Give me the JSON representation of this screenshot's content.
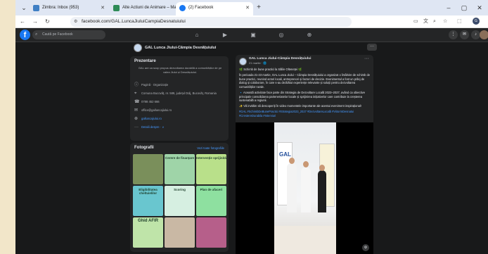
{
  "browser": {
    "tabs": [
      {
        "title": "Zimbra: Inbox (953)",
        "favicon_color": "#3f7fc4"
      },
      {
        "title": "Alte Actiuni de Animare – Mara",
        "favicon_color": "#2e8b57"
      },
      {
        "title": "(2) Facebook",
        "favicon_color": "#1877f2"
      }
    ],
    "new_tab": "+",
    "url": "facebook.com/GAL.LuncaJiuluiCampiaDesnatuiului"
  },
  "facebook": {
    "logo": "f",
    "search_placeholder": "Caută pe Facebook",
    "group_name": "GAL Lunca Jiului-Câmpia Desnățuiului",
    "intro": {
      "title": "Prezentare",
      "description": "GAL are ca scop propus dezvoltarea durabilă a comunităților de pe valea Jiului și Desnățuiului.",
      "rows": [
        {
          "icon": "info-icon",
          "text": "Pagină · Organizație"
        },
        {
          "icon": "location-icon",
          "text": "Comuna Bucovăț, nr. 589, județul Dolj, Bucovăț, Romania"
        },
        {
          "icon": "phone-icon",
          "text": "0788 452 666"
        },
        {
          "icon": "email-icon",
          "text": "office@galluncajiului.ro"
        },
        {
          "icon": "web-icon",
          "text": "galluncajiului.ro",
          "link": true
        },
        {
          "icon": "more-icon",
          "text": "Detalii despre · ∨",
          "link": true
        }
      ]
    },
    "photos": {
      "title": "Fotografii",
      "see_all": "Vezi toate fotografiile",
      "tiles": [
        {
          "label": "",
          "color": "#7a8f5b"
        },
        {
          "label": "Cerere de finanțare",
          "color": "#9fd4a8"
        },
        {
          "label": "Intervenție sprijinită",
          "color": "#b9e08a"
        },
        {
          "label": "Eligibilitatea cheltuielilor",
          "color": "#69c6cf"
        },
        {
          "label": "Scoring",
          "color": "#d6efe1"
        },
        {
          "label": "Plan de afaceri",
          "color": "#8ee0a0"
        },
        {
          "label": "Ghid AFIR",
          "color": "#bfe4a9"
        },
        {
          "label": "",
          "color": "#c9b8a4"
        },
        {
          "label": "",
          "color": "#b65f8a"
        }
      ]
    },
    "post": {
      "author": "GAL Lunca Jiului-Câmpia Desnățuiului",
      "time": "21 martie · 🌐",
      "paragraphs": [
        "🌿 Schimb de bune practici la Sălile Olteneței 🌿",
        "În perioada 21-23 martie, GAL Lunca Jiului – Câmpia Desnățuiului a organizat o întâlnire de schimb de bune practici, reunind actori locali, antreprenori și factori de decizie. Evenimentul a fost un prilej de dialog și colaborare, în care s-au dezbătut experiențe relevante și soluții pentru dezvoltarea comunităților rurale.",
        "🔹 Această activitate face parte din Strategia de Dezvoltare Locală 2023–2027, având ca obiective principale consolidarea parteneriatelor locale și sprijinirea inițiativelor care contribuie la creșterea sustenabilă a regiunii.",
        "✨ Vă invităm să descoperiți în video momentele importante ale acestui eveniment inspirațional!"
      ],
      "hashtags": "#GAL #SchimbDeBunePractici #Strategia2023_2027 #DezvoltareLocală #ViitorInDesnatui #CrestereDurabila #Interviuri"
    },
    "video_banner": "GAL",
    "corner_badge": "⚙"
  }
}
